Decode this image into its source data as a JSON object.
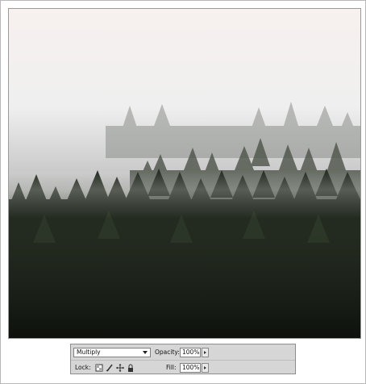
{
  "layers_panel": {
    "blend_mode": "Multiply",
    "opacity_label": "Opacity:",
    "opacity_value": "100%",
    "lock_label": "Lock:",
    "fill_label": "Fill:",
    "fill_value": "100%",
    "lock_icons": [
      "lock-transparent-pixels-icon",
      "lock-image-pixels-icon",
      "lock-position-icon",
      "lock-all-icon"
    ]
  }
}
